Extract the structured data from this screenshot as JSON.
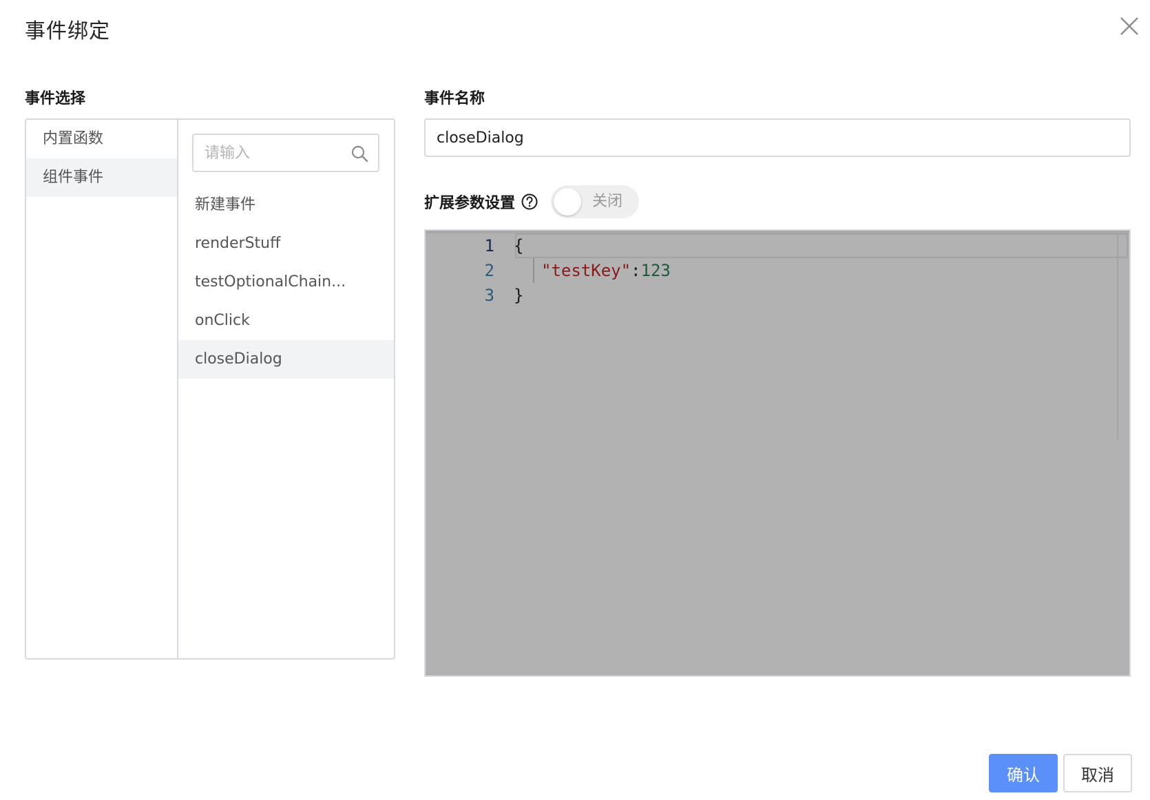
{
  "dialog": {
    "title": "事件绑定"
  },
  "event_select": {
    "label": "事件选择",
    "categories": [
      {
        "label": "内置函数",
        "active": false
      },
      {
        "label": "组件事件",
        "active": true
      }
    ],
    "search": {
      "placeholder": "请输入",
      "value": ""
    },
    "events": [
      {
        "label": "新建事件",
        "active": false
      },
      {
        "label": "renderStuff",
        "active": false
      },
      {
        "label": "testOptionalChain...",
        "active": false
      },
      {
        "label": "onClick",
        "active": false
      },
      {
        "label": "closeDialog",
        "active": true
      }
    ]
  },
  "event_name": {
    "label": "事件名称",
    "value": "closeDialog"
  },
  "ext_params": {
    "label": "扩展参数设置",
    "toggle_text": "关闭",
    "toggle_on": false
  },
  "editor": {
    "lines": [
      {
        "no": "1",
        "open": "{"
      },
      {
        "no": "2",
        "key": "\"testKey\"",
        "colon": ":",
        "num": "123"
      },
      {
        "no": "3",
        "close": "}"
      }
    ]
  },
  "footer": {
    "confirm_label": "确认",
    "cancel_label": "取消"
  },
  "colors": {
    "primary": "#5b8ff9",
    "editor_bg": "#b2b2b2",
    "border": "#d6d9e0",
    "active_bg": "#f2f3f5"
  },
  "icons": {
    "close": "close-icon",
    "search": "search-icon",
    "help": "question-circle-icon"
  }
}
